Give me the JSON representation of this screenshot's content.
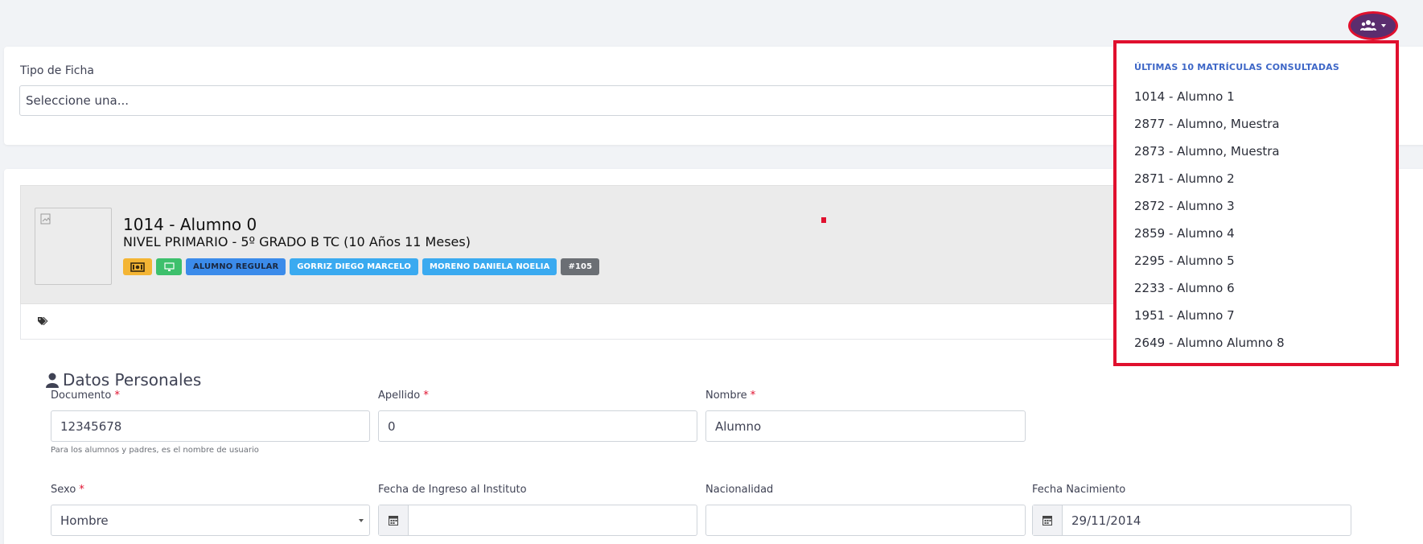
{
  "header": {
    "user_menu_icon": "users-icon"
  },
  "ficha": {
    "label": "Tipo de Ficha",
    "select_value": "Seleccione una..."
  },
  "profile": {
    "name": "1014 - Alumno 0",
    "level": "NIVEL PRIMARIO - 5º GRADO B TC (10 Años 11 Meses)",
    "badges": {
      "status": "ALUMNO REGULAR",
      "teacher1": "GORRIZ DIEGO MARCELO",
      "teacher2": "MORENO DANIELA NOELIA",
      "number": "#105"
    },
    "colors": {
      "yellow": "#f4b534",
      "green": "#3dc06c",
      "blue": "#3b8bea",
      "sky": "#3aaaf0",
      "gray": "#6b6f74"
    }
  },
  "personal": {
    "title": "Datos Personales",
    "documento": {
      "label": "Documento",
      "value": "12345678",
      "help": "Para los alumnos y padres, es el nombre de usuario"
    },
    "apellido": {
      "label": "Apellido",
      "value": "0"
    },
    "nombre": {
      "label": "Nombre",
      "value": "Alumno"
    },
    "sexo": {
      "label": "Sexo",
      "value": "Hombre"
    },
    "fecha_ingreso": {
      "label": "Fecha de Ingreso al Instituto",
      "value": ""
    },
    "nacionalidad": {
      "label": "Nacionalidad",
      "value": ""
    },
    "fecha_nacimiento": {
      "label": "Fecha Nacimiento",
      "value": "29/11/2014"
    },
    "required_mark": "*"
  },
  "dropdown": {
    "title": "ÚLTIMAS 10 MATRÍCULAS CONSULTADAS",
    "items": [
      "1014 - Alumno 1",
      "2877 - Alumno, Muestra",
      "2873 - Alumno, Muestra",
      "2871 - Alumno 2",
      "2872 - Alumno 3",
      "2859 - Alumno 4",
      "2295 - Alumno 5",
      "2233 - Alumno 6",
      "1951 - Alumno 7",
      "2649 - Alumno Alumno 8"
    ],
    "accent_color": "#e0102e"
  }
}
